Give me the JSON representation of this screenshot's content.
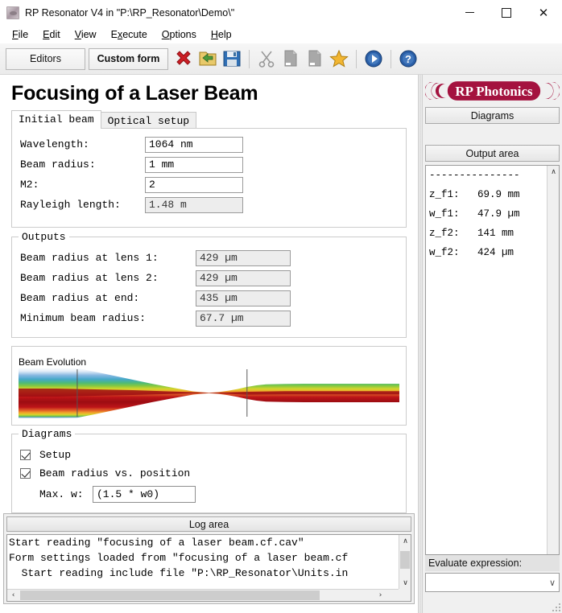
{
  "window": {
    "title": "RP Resonator V4 in \"P:\\RP_Resonator\\Demo\\\"",
    "icon": "app-icon",
    "minimize": "–",
    "maximize": "□",
    "close": "✕"
  },
  "menubar": {
    "items": [
      {
        "pre": "",
        "accel": "F",
        "post": "ile"
      },
      {
        "pre": "",
        "accel": "E",
        "post": "dit"
      },
      {
        "pre": "",
        "accel": "V",
        "post": "iew"
      },
      {
        "pre": "E",
        "accel": "x",
        "post": "ecute"
      },
      {
        "pre": "",
        "accel": "O",
        "post": "ptions"
      },
      {
        "pre": "",
        "accel": "H",
        "post": "elp"
      }
    ]
  },
  "toolbar": {
    "editors_label": "Editors",
    "custom_form_label": "Custom form",
    "icons": [
      "delete-cross-icon",
      "open-folder-icon",
      "save-disk-icon",
      "cut-scissors-icon",
      "copy-page-icon",
      "paste-page-icon",
      "favorite-star-icon",
      "run-play-icon",
      "help-question-icon"
    ]
  },
  "main": {
    "page_title": "Focusing of a Laser Beam",
    "tabs": [
      {
        "label": "Initial beam",
        "selected": true
      },
      {
        "label": "Optical setup",
        "selected": false
      }
    ],
    "initial_beam": {
      "fields": [
        {
          "label": "Wavelength:",
          "value": "1064 nm",
          "readonly": false
        },
        {
          "label": "Beam radius:",
          "value": "1 mm",
          "readonly": false
        },
        {
          "label": "M2:",
          "value": "2",
          "readonly": false
        },
        {
          "label": "Rayleigh length:",
          "value": "1.48 m",
          "readonly": true
        }
      ]
    },
    "outputs": {
      "legend": "Outputs",
      "fields": [
        {
          "label": "Beam radius at lens 1:",
          "value": "429 µm"
        },
        {
          "label": "Beam radius at lens 2:",
          "value": "429 µm"
        },
        {
          "label": "Beam radius at end:",
          "value": "435 µm"
        },
        {
          "label": "Minimum beam radius:",
          "value": "67.7 µm"
        }
      ]
    },
    "beam_evolution": {
      "legend": "Beam Evolution"
    },
    "diagrams": {
      "legend": "Diagrams",
      "checkboxes": [
        {
          "label": "Setup",
          "checked": true
        },
        {
          "label": "Beam radius vs. position",
          "checked": true
        }
      ],
      "max_w_label": "Max. w:",
      "max_w_value": "(1.5 * w0)"
    },
    "log": {
      "header": "Log area",
      "lines": [
        "Start reading \"focusing of a laser beam.cf.cav\"",
        "Form settings loaded from \"focusing of a laser beam.cf",
        "  Start reading include file \"P:\\RP_Resonator\\Units.in"
      ],
      "scroll_up": "∧",
      "scroll_down": "∨",
      "scroll_left": "‹",
      "scroll_right": "›"
    }
  },
  "sidebar": {
    "logo_text": "RP Photonics",
    "diagrams_button": "Diagrams",
    "output_area_button": "Output area",
    "output_text": [
      "---------------",
      "z_f1:   69.9 mm",
      "w_f1:   47.9 µm",
      "z_f2:   141 mm",
      "w_f2:   424 µm"
    ],
    "scroll_up": "∧",
    "evaluate_label": "Evaluate expression:",
    "evaluate_value": "",
    "evaluate_caret": "∨"
  },
  "colors": {
    "brand_red": "#A4123F",
    "accent_blue": "#1a6fc4",
    "window_bg": "#f0f0f0",
    "panel_bg": "#ffffff"
  },
  "chart_data": {
    "type": "area",
    "title": "Beam Evolution",
    "description": "Colormap (jet) rendering of Gaussian beam radius w(z) along propagation axis; two vertical lens lines.",
    "xlabel": "",
    "ylabel": "",
    "lens_positions_frac": [
      0.155,
      0.6
    ],
    "x": [
      0.0,
      0.05,
      0.1,
      0.155,
      0.2,
      0.25,
      0.3,
      0.35,
      0.4,
      0.43,
      0.46,
      0.5,
      0.53,
      0.56,
      0.6,
      0.65,
      0.7,
      0.75,
      0.8,
      0.85,
      0.9,
      0.95,
      1.0
    ],
    "w": [
      1.0,
      1.0,
      1.0,
      1.0,
      0.88,
      0.74,
      0.6,
      0.46,
      0.3,
      0.2,
      0.1,
      0.04,
      0.12,
      0.24,
      0.42,
      0.52,
      0.55,
      0.55,
      0.55,
      0.55,
      0.55,
      0.55,
      0.55
    ]
  }
}
